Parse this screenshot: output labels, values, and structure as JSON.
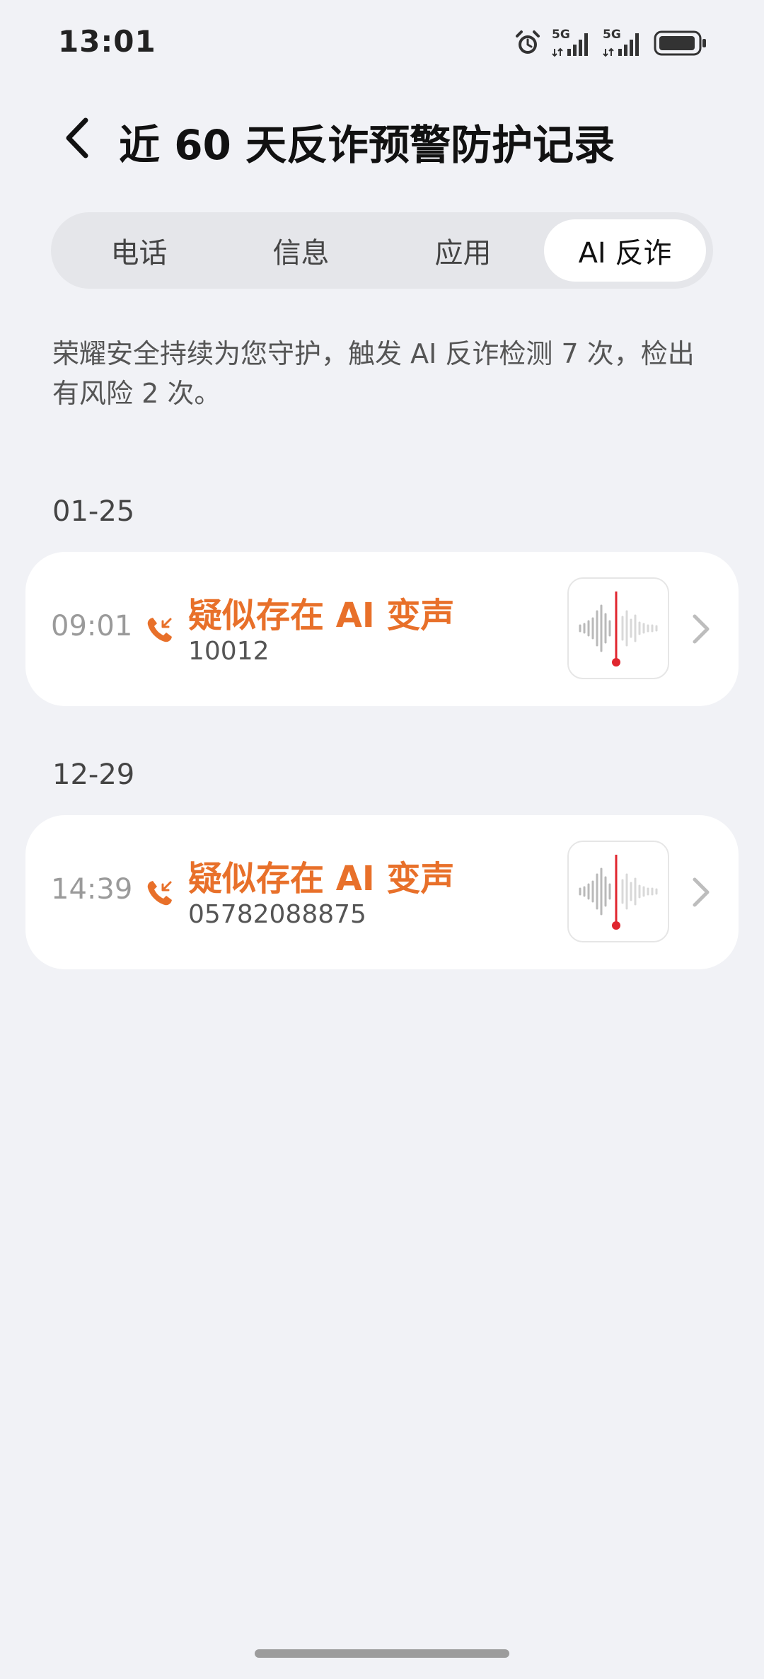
{
  "status_bar": {
    "time": "13:01",
    "icons": [
      "alarm-icon",
      "5g-signal-icon",
      "5g-signal-icon",
      "battery-icon"
    ],
    "network_1": "5G",
    "network_2": "5G"
  },
  "header": {
    "back_icon": "chevron-left-icon",
    "title": "近 60 天反诈预警防护记录"
  },
  "tabs": [
    {
      "label": "电话",
      "active": false
    },
    {
      "label": "信息",
      "active": false
    },
    {
      "label": "应用",
      "active": false
    },
    {
      "label": "AI 反诈",
      "active": true
    }
  ],
  "summary": "荣耀安全持续为您守护，触发 AI 反诈检测 7 次，检出有风险 2 次。",
  "groups": [
    {
      "date": "01-25",
      "records": [
        {
          "time": "09:01",
          "title": "疑似存在 AI 变声",
          "number": "10012",
          "icon": "incoming-call-icon"
        }
      ]
    },
    {
      "date": "12-29",
      "records": [
        {
          "time": "14:39",
          "title": "疑似存在 AI 变声",
          "number": "05782088875",
          "icon": "incoming-call-icon"
        }
      ]
    }
  ],
  "colors": {
    "background": "#f1f2f6",
    "accent_orange": "#e8702a",
    "wave_marker_red": "#e0262f"
  }
}
